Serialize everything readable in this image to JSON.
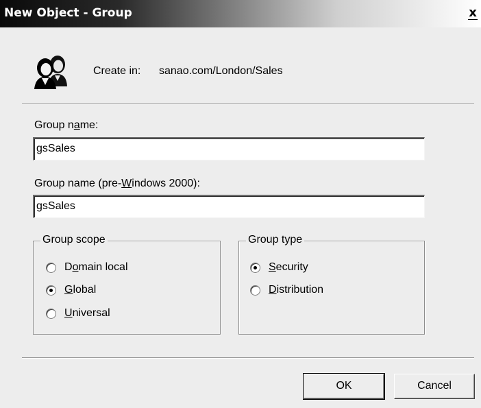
{
  "window": {
    "title": "New Object - Group",
    "close_symbol": "x"
  },
  "header": {
    "icon": "group-users-icon",
    "create_in_label": "Create in:",
    "create_in_value": "sanao.com/London/Sales"
  },
  "form": {
    "group_name_label": "Group name:",
    "group_name_value": "gsSales",
    "group_name_pre2000_label": "Group name (pre-Windows 2000):",
    "group_name_pre2000_value": "gsSales"
  },
  "group_scope": {
    "legend": "Group scope",
    "options": [
      {
        "label": "Domain local",
        "checked": false
      },
      {
        "label": "Global",
        "checked": true
      },
      {
        "label": "Universal",
        "checked": false
      }
    ]
  },
  "group_type": {
    "legend": "Group type",
    "options": [
      {
        "label": "Security",
        "checked": true
      },
      {
        "label": "Distribution",
        "checked": false
      }
    ]
  },
  "buttons": {
    "ok_label": "OK",
    "cancel_label": "Cancel"
  }
}
